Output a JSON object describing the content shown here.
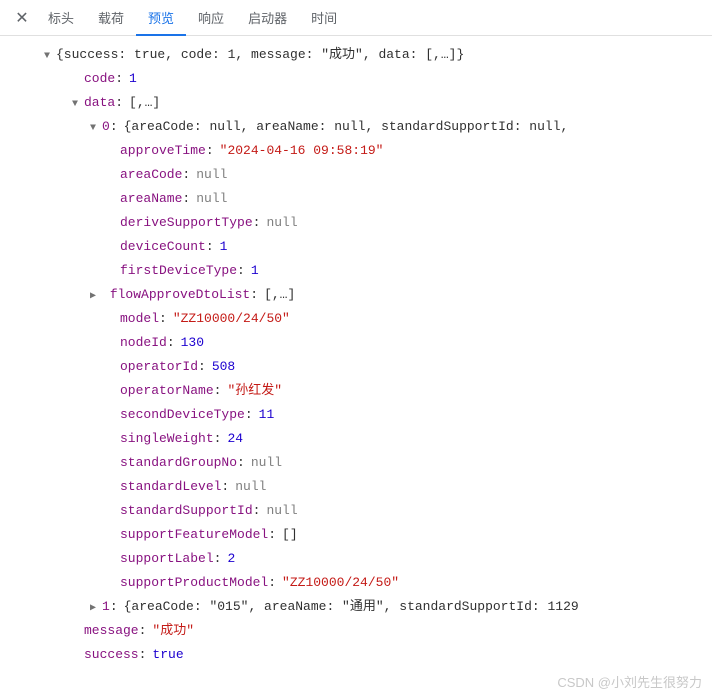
{
  "tabs": {
    "items": [
      {
        "label": "标头"
      },
      {
        "label": "载荷"
      },
      {
        "label": "预览"
      },
      {
        "label": "响应"
      },
      {
        "label": "启动器"
      },
      {
        "label": "时间"
      }
    ],
    "activeIndex": 2
  },
  "root": {
    "summary": "{success: true, code: 1, message: \"成功\", data: [,…]}",
    "code_key": "code",
    "code_val": "1",
    "data_key": "data",
    "data_summary": "[,…]",
    "item0_index": "0",
    "item0_summary": "{areaCode: null, areaName: null, standardSupportId: null,",
    "props": {
      "approveTime_k": "approveTime",
      "approveTime_v": "\"2024-04-16 09:58:19\"",
      "areaCode_k": "areaCode",
      "areaCode_v": "null",
      "areaName_k": "areaName",
      "areaName_v": "null",
      "deriveSupportType_k": "deriveSupportType",
      "deriveSupportType_v": "null",
      "deviceCount_k": "deviceCount",
      "deviceCount_v": "1",
      "firstDeviceType_k": "firstDeviceType",
      "firstDeviceType_v": "1",
      "flowApproveDtoList_k": "flowApproveDtoList",
      "flowApproveDtoList_v": "[,…]",
      "model_k": "model",
      "model_v": "\"ZZ10000/24/50\"",
      "nodeId_k": "nodeId",
      "nodeId_v": "130",
      "operatorId_k": "operatorId",
      "operatorId_v": "508",
      "operatorName_k": "operatorName",
      "operatorName_v": "\"孙红发\"",
      "secondDeviceType_k": "secondDeviceType",
      "secondDeviceType_v": "11",
      "singleWeight_k": "singleWeight",
      "singleWeight_v": "24",
      "standardGroupNo_k": "standardGroupNo",
      "standardGroupNo_v": "null",
      "standardLevel_k": "standardLevel",
      "standardLevel_v": "null",
      "standardSupportId_k": "standardSupportId",
      "standardSupportId_v": "null",
      "supportFeatureModel_k": "supportFeatureModel",
      "supportFeatureModel_v": "[]",
      "supportLabel_k": "supportLabel",
      "supportLabel_v": "2",
      "supportProductModel_k": "supportProductModel",
      "supportProductModel_v": "\"ZZ10000/24/50\""
    },
    "item1_index": "1",
    "item1_summary": "{areaCode: \"015\", areaName: \"通用\", standardSupportId: 1129",
    "message_k": "message",
    "message_v": "\"成功\"",
    "success_k": "success",
    "success_v": "true"
  },
  "watermark": "CSDN @小刘先生很努力"
}
